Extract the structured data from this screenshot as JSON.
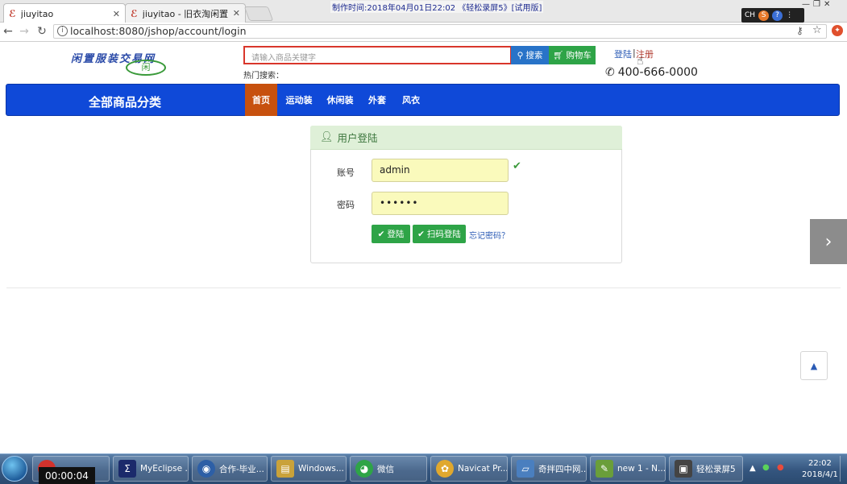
{
  "browser": {
    "tabs": [
      {
        "label": "jiuyitao",
        "close": "✕"
      },
      {
        "label": "jiuyitao - 旧衣淘闲置交易",
        "close": "✕"
      }
    ],
    "recording_banner": "制作时间:2018年04月01日22:02 《轻松录屏5》[试用版]",
    "url": "localhost:8080/jshop/account/login",
    "capture_tray": {
      "lang": "CH"
    }
  },
  "header": {
    "logo_text": "闲置服装交易网",
    "logo_badge": "闲",
    "search_placeholder": "请输入商品关键字",
    "search_label": "搜索",
    "cart_label": "购物车",
    "hot_search": "热门搜索：",
    "login_link": "登陆",
    "separator": "|",
    "register_link": "注册",
    "phone": "400-666-0000"
  },
  "nav": {
    "all_categories": "全部商品分类",
    "items": [
      "首页",
      "运动装",
      "休闲装",
      "外套",
      "风衣"
    ],
    "active_index": 0
  },
  "login": {
    "panel_title": "用户登陆",
    "account_label": "账号",
    "account_value": "admin",
    "password_label": "密码",
    "password_value": "••••••",
    "login_button": "登陆",
    "qr_login_button": "扫码登陆",
    "forgot": "忘记密码？"
  },
  "taskbar": {
    "timer": "00:00:04",
    "tasks": [
      {
        "label": "MyEclipse ...",
        "color": "#1b2a6b"
      },
      {
        "label": "合作-毕业...",
        "color": "#2d5fa6"
      },
      {
        "label": "Windows...",
        "color": "#c9a23a"
      },
      {
        "label": "微信",
        "color": "#2ea447"
      },
      {
        "label": "Navicat Pr...",
        "color": "#e0a82e"
      },
      {
        "label": "奇拌四中网...",
        "color": "#4a7fbf"
      },
      {
        "label": "new 1 - N...",
        "color": "#6a9e3a"
      },
      {
        "label": "轻松录屏5",
        "color": "#444"
      }
    ],
    "clock_time": "22:02",
    "clock_date": "2018/4/1"
  },
  "colors": {
    "nav_blue": "#0f49d8",
    "nav_active": "#c7510e",
    "green_button": "#2ea447",
    "search_border": "#d9362b",
    "input_fill": "#fafabc"
  }
}
